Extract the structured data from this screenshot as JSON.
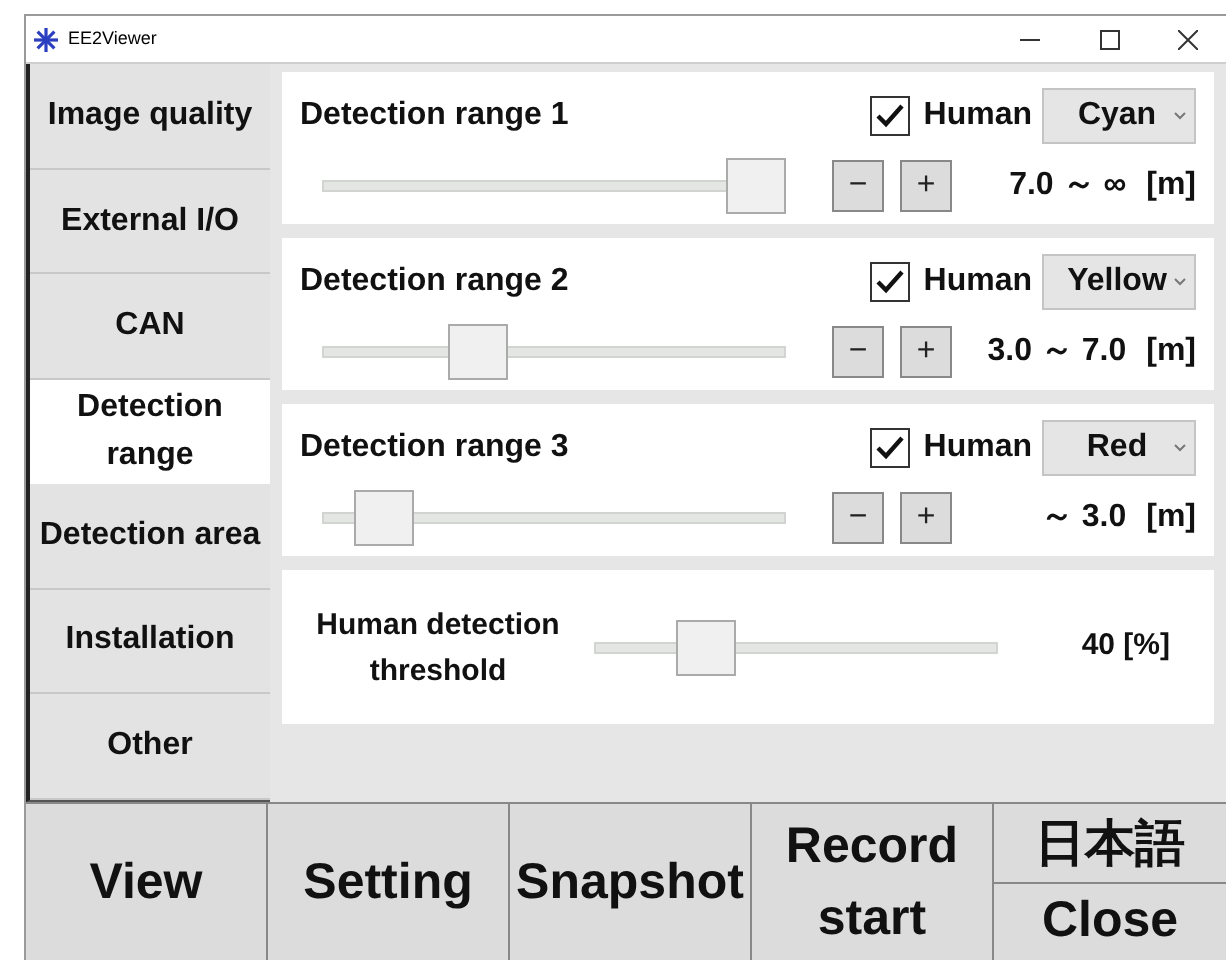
{
  "window": {
    "title": "EE2Viewer"
  },
  "sidebar": {
    "tabs": [
      {
        "label": "Image quality",
        "selected": false
      },
      {
        "label": "External I/O",
        "selected": false
      },
      {
        "label": "CAN",
        "selected": false
      },
      {
        "label": "Detection range",
        "selected": true
      },
      {
        "label": "Detection area",
        "selected": false
      },
      {
        "label": "Installation",
        "selected": false
      },
      {
        "label": "Other",
        "selected": false
      }
    ]
  },
  "ranges": [
    {
      "title": "Detection range 1",
      "human": {
        "label": "Human",
        "checked": true
      },
      "dropdown": "Cyan",
      "minus": "−",
      "plus": "+",
      "level": 1,
      "reading": "7.0 ～ ∞",
      "unit": "[m]"
    },
    {
      "title": "Detection range 2",
      "human": {
        "label": "Human",
        "checked": true
      },
      "dropdown": "Yellow",
      "minus": "−",
      "plus": "+",
      "level": 0.31,
      "reading": "3.0 ～ 7.0",
      "unit": "[m]"
    },
    {
      "title": "Detection range 3",
      "human": {
        "label": "Human",
        "checked": true
      },
      "dropdown": "Red",
      "minus": "−",
      "plus": "+",
      "level": 0.08,
      "reading": "～ 3.0",
      "unit": "[m]"
    }
  ],
  "threshold": {
    "label": "Human detection threshold",
    "level": 0.24,
    "reading": "40 [%]"
  },
  "bottom_buttons": [
    {
      "kind": "single",
      "label": "View"
    },
    {
      "kind": "single",
      "label": "Setting"
    },
    {
      "kind": "single",
      "label": "Snapshot"
    },
    {
      "kind": "single",
      "label": "Record start"
    },
    {
      "kind": "stack",
      "labels": [
        "日本語",
        "Close"
      ]
    }
  ]
}
